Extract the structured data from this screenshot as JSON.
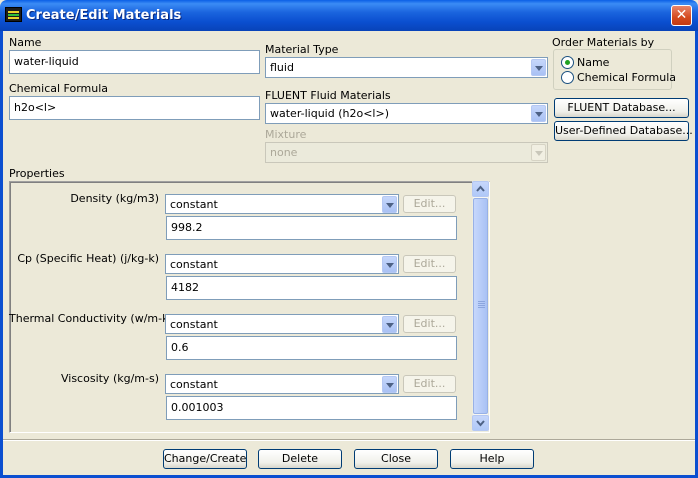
{
  "window": {
    "title": "Create/Edit Materials",
    "close_glyph": "✕"
  },
  "name": {
    "label": "Name",
    "value": "water-liquid"
  },
  "chemical_formula": {
    "label": "Chemical Formula",
    "value": "h2o<l>"
  },
  "material_type": {
    "label": "Material Type",
    "value": "fluid"
  },
  "fluent_fluid_materials": {
    "label": "FLUENT Fluid Materials",
    "value": "water-liquid (h2o<l>)"
  },
  "mixture": {
    "label": "Mixture",
    "value": "none"
  },
  "order_by": {
    "label": "Order Materials by",
    "options": [
      {
        "label": "Name",
        "checked": true
      },
      {
        "label": "Chemical Formula",
        "checked": false
      }
    ]
  },
  "buttons": {
    "fluent_database": "FLUENT Database...",
    "user_defined_database": "User-Defined Database...",
    "change_create": "Change/Create",
    "delete": "Delete",
    "close": "Close",
    "help": "Help"
  },
  "properties": {
    "label": "Properties",
    "items": [
      {
        "label": "Density (kg/m3)",
        "method": "constant",
        "edit": "Edit...",
        "value": "998.2"
      },
      {
        "label": "Cp (Specific Heat) (j/kg-k)",
        "method": "constant",
        "edit": "Edit...",
        "value": "4182"
      },
      {
        "label": "Thermal Conductivity (w/m-k)",
        "method": "constant",
        "edit": "Edit...",
        "value": "0.6"
      },
      {
        "label": "Viscosity (kg/m-s)",
        "method": "constant",
        "edit": "Edit...",
        "value": "0.001003"
      }
    ]
  },
  "colors": {
    "titlebar": "#0b4fd0",
    "dialog_bg": "#ece9d8",
    "field_border": "#7f9db9",
    "disabled_text": "#aca899"
  },
  "icons": {
    "window_icon": "fluent-app-icon",
    "close": "close-icon",
    "dropdown": "chevron-down-icon",
    "scroll_up": "arrow-up-icon",
    "scroll_down": "arrow-down-icon"
  }
}
